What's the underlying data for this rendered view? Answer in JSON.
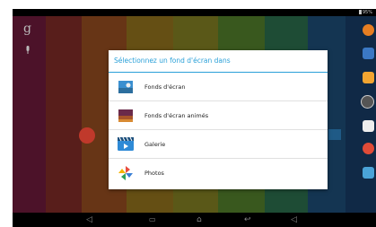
{
  "status_bar": {
    "battery": "95%"
  },
  "wallpaper_colors": [
    "#6a1a3a",
    "#7a2a26",
    "#8f4a1f",
    "#8c6e1c",
    "#6e7a22",
    "#3d6e2c",
    "#2a5c5e",
    "#1c4a72",
    "#173a62"
  ],
  "dialog": {
    "title": "Sélectionnez un fond d'écran dans",
    "options": [
      {
        "label": "Fonds d'écran",
        "icon": "wallpaper-icon"
      },
      {
        "label": "Fonds d'écran animés",
        "icon": "live-wallpaper-icon"
      },
      {
        "label": "Galerie",
        "icon": "gallery-icon"
      },
      {
        "label": "Photos",
        "icon": "photos-icon"
      }
    ]
  },
  "home_screen": {
    "search_glyph": "g",
    "left_icons": [
      "google-search-icon",
      "voice-search-icon"
    ],
    "right_icons": [
      "headphones-icon",
      "play-movies-icon",
      "keep-icon",
      "app-drawer-icon",
      "gmail-icon",
      "chrome-icon",
      "play-store-icon"
    ]
  },
  "nav_bar": {
    "buttons": [
      "volume-down",
      "recents",
      "home",
      "back",
      "volume-up"
    ]
  }
}
